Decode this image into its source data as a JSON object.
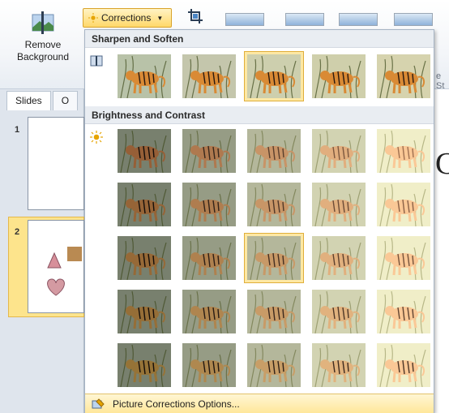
{
  "ribbon": {
    "remove_background_label": "Remove Background",
    "corrections_label": "Corrections",
    "styles_tag": "e St"
  },
  "left_pane": {
    "tabs": [
      {
        "label": "Slides"
      },
      {
        "label": "O"
      }
    ],
    "slides": [
      {
        "number": "1"
      },
      {
        "number": "2"
      }
    ]
  },
  "canvas_letter": "C",
  "gallery": {
    "sections": [
      {
        "title": "Sharpen and Soften",
        "icon": "sharpen-icon",
        "rows": 1,
        "cols": 5,
        "selected": [
          0,
          2
        ]
      },
      {
        "title": "Brightness and Contrast",
        "icon": "brightness-icon",
        "rows": 5,
        "cols": 5,
        "selected": [
          2,
          2
        ]
      }
    ],
    "options_label": "Picture Corrections Options..."
  },
  "colors": {
    "accent": "#b55a96",
    "hover": "#ffd86a",
    "selected_border": "#e0ae3a"
  }
}
